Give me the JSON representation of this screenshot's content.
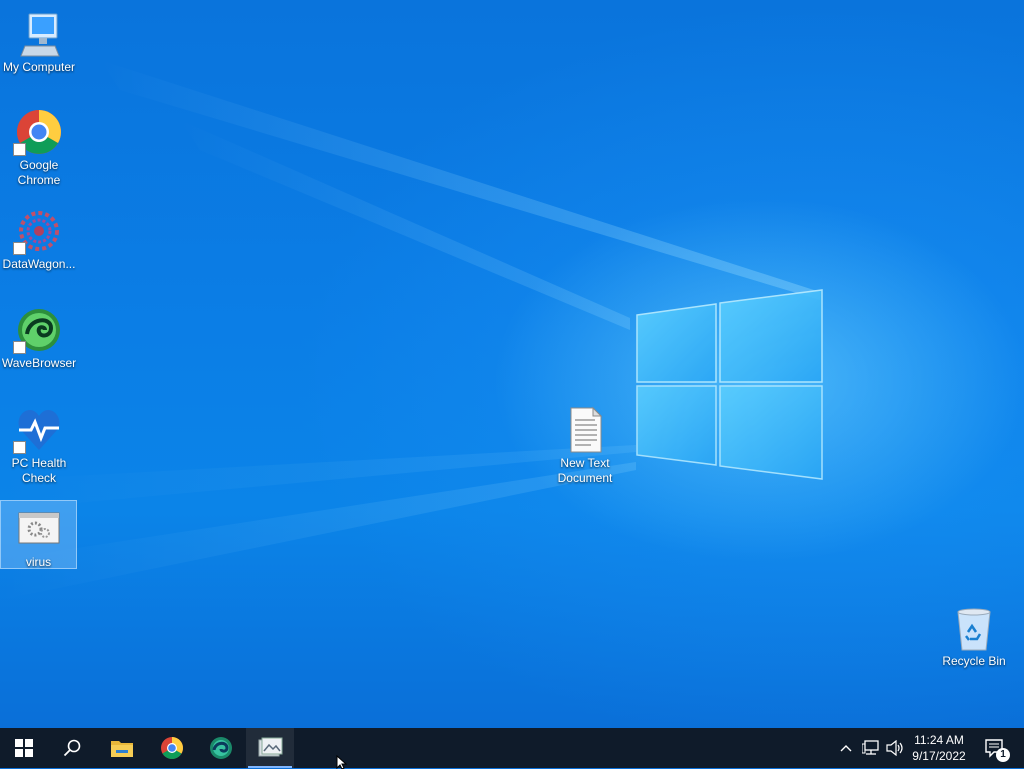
{
  "desktop": {
    "icons": [
      {
        "id": "my-computer",
        "label": "My Computer"
      },
      {
        "id": "chrome",
        "label": "Google Chrome"
      },
      {
        "id": "datawagon",
        "label": "DataWagon..."
      },
      {
        "id": "wavebrowser",
        "label": "WaveBrowser"
      },
      {
        "id": "pc-health",
        "label": "PC Health Check"
      },
      {
        "id": "virus",
        "label": "virus"
      },
      {
        "id": "new-text",
        "label": "New Text Document"
      },
      {
        "id": "recycle-bin",
        "label": "Recycle Bin"
      }
    ]
  },
  "taskbar": {
    "pinned": [
      "start-windows-icon",
      "search-icon",
      "file-explorer-icon",
      "chrome-icon",
      "edge-icon",
      "photo-app-icon"
    ],
    "clock": {
      "time": "11:24 AM",
      "date": "9/17/2022"
    },
    "notification_count": "1"
  },
  "colors": {
    "taskbar": "#0f1b2a",
    "desktop": "#0a74dc",
    "accent": "#7fb6ff"
  }
}
